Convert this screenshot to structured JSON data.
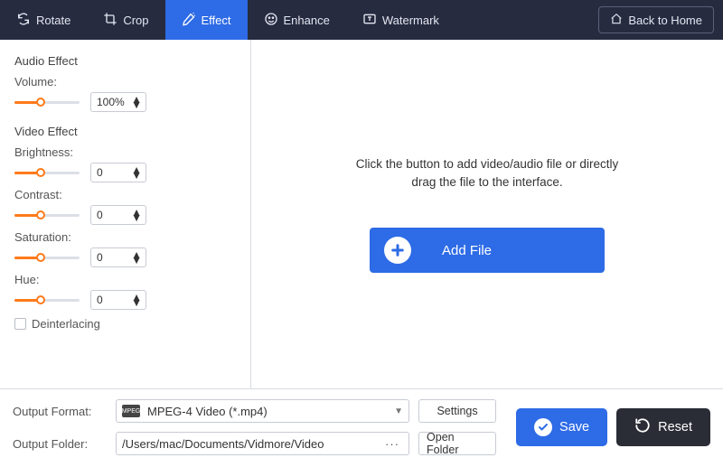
{
  "toolbar": {
    "items": [
      {
        "label": "Rotate",
        "icon": "rotate-icon",
        "active": false
      },
      {
        "label": "Crop",
        "icon": "crop-icon",
        "active": false
      },
      {
        "label": "Effect",
        "icon": "effect-icon",
        "active": true
      },
      {
        "label": "Enhance",
        "icon": "enhance-icon",
        "active": false
      },
      {
        "label": "Watermark",
        "icon": "watermark-icon",
        "active": false
      }
    ],
    "back_label": "Back to Home"
  },
  "sidebar": {
    "audio_section_title": "Audio Effect",
    "volume_label": "Volume:",
    "volume_value": "100%",
    "volume_fill_pct": 40,
    "video_section_title": "Video Effect",
    "brightness_label": "Brightness:",
    "brightness_value": "0",
    "brightness_fill_pct": 40,
    "contrast_label": "Contrast:",
    "contrast_value": "0",
    "contrast_fill_pct": 40,
    "saturation_label": "Saturation:",
    "saturation_value": "0",
    "saturation_fill_pct": 40,
    "hue_label": "Hue:",
    "hue_value": "0",
    "hue_fill_pct": 40,
    "deinterlacing_label": "Deinterlacing",
    "deinterlacing_checked": false
  },
  "preview": {
    "hint_line1": "Click the button to add video/audio file or directly",
    "hint_line2": "drag the file to the interface.",
    "add_file_label": "Add File"
  },
  "bottom": {
    "format_label": "Output Format:",
    "format_value": "MPEG-4 Video (*.mp4)",
    "settings_label": "Settings",
    "folder_label": "Output Folder:",
    "folder_value": "/Users/mac/Documents/Vidmore/Video",
    "open_folder_label": "Open Folder",
    "save_label": "Save",
    "reset_label": "Reset",
    "mp4_badge": "MPEG"
  },
  "colors": {
    "accent": "#2e6be6",
    "toolbar_bg": "#262b40",
    "slider_fill": "#ff7a1a",
    "reset_bg": "#2a2d35"
  }
}
